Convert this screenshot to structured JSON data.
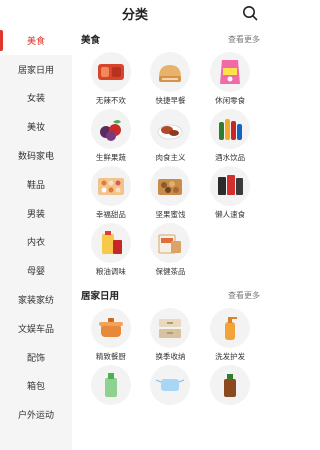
{
  "header": {
    "title": "分类",
    "search_icon": "search-icon"
  },
  "sidebar": {
    "items": [
      {
        "label": "美食",
        "active": true
      },
      {
        "label": "居家日用"
      },
      {
        "label": "女装"
      },
      {
        "label": "美妆"
      },
      {
        "label": "数码家电"
      },
      {
        "label": "鞋品"
      },
      {
        "label": "男装"
      },
      {
        "label": "内衣"
      },
      {
        "label": "母婴"
      },
      {
        "label": "家装家纺"
      },
      {
        "label": "文娱车品"
      },
      {
        "label": "配饰"
      },
      {
        "label": "箱包"
      },
      {
        "label": "户外运动"
      }
    ]
  },
  "sections": [
    {
      "title": "美食",
      "more": "查看更多",
      "items": [
        {
          "label": "无辣不欢",
          "icon": "spicy-meat-icon"
        },
        {
          "label": "快捷早餐",
          "icon": "bread-icon"
        },
        {
          "label": "休闲零食",
          "icon": "snack-bag-icon"
        },
        {
          "label": "生鲜果蔬",
          "icon": "fruit-icon"
        },
        {
          "label": "肉食主义",
          "icon": "meat-icon"
        },
        {
          "label": "酒水饮品",
          "icon": "drinks-icon"
        },
        {
          "label": "幸福甜品",
          "icon": "dessert-box-icon"
        },
        {
          "label": "坚果蜜饯",
          "icon": "nuts-icon"
        },
        {
          "label": "懒人速食",
          "icon": "instant-food-icon"
        },
        {
          "label": "粮油调味",
          "icon": "oil-rice-icon"
        },
        {
          "label": "保健茶品",
          "icon": "tea-box-icon"
        }
      ]
    },
    {
      "title": "居家日用",
      "more": "查看更多",
      "items": [
        {
          "label": "精致餐厨",
          "icon": "pot-icon"
        },
        {
          "label": "换季收纳",
          "icon": "storage-box-icon"
        },
        {
          "label": "洗发护发",
          "icon": "shampoo-icon"
        },
        {
          "label": "",
          "icon": "bottle-icon"
        },
        {
          "label": "",
          "icon": "mask-icon"
        },
        {
          "label": "",
          "icon": "disinfectant-icon"
        }
      ]
    }
  ],
  "colors": {
    "accent": "#e0362b",
    "sidebar_bg": "#f5f5f5"
  }
}
